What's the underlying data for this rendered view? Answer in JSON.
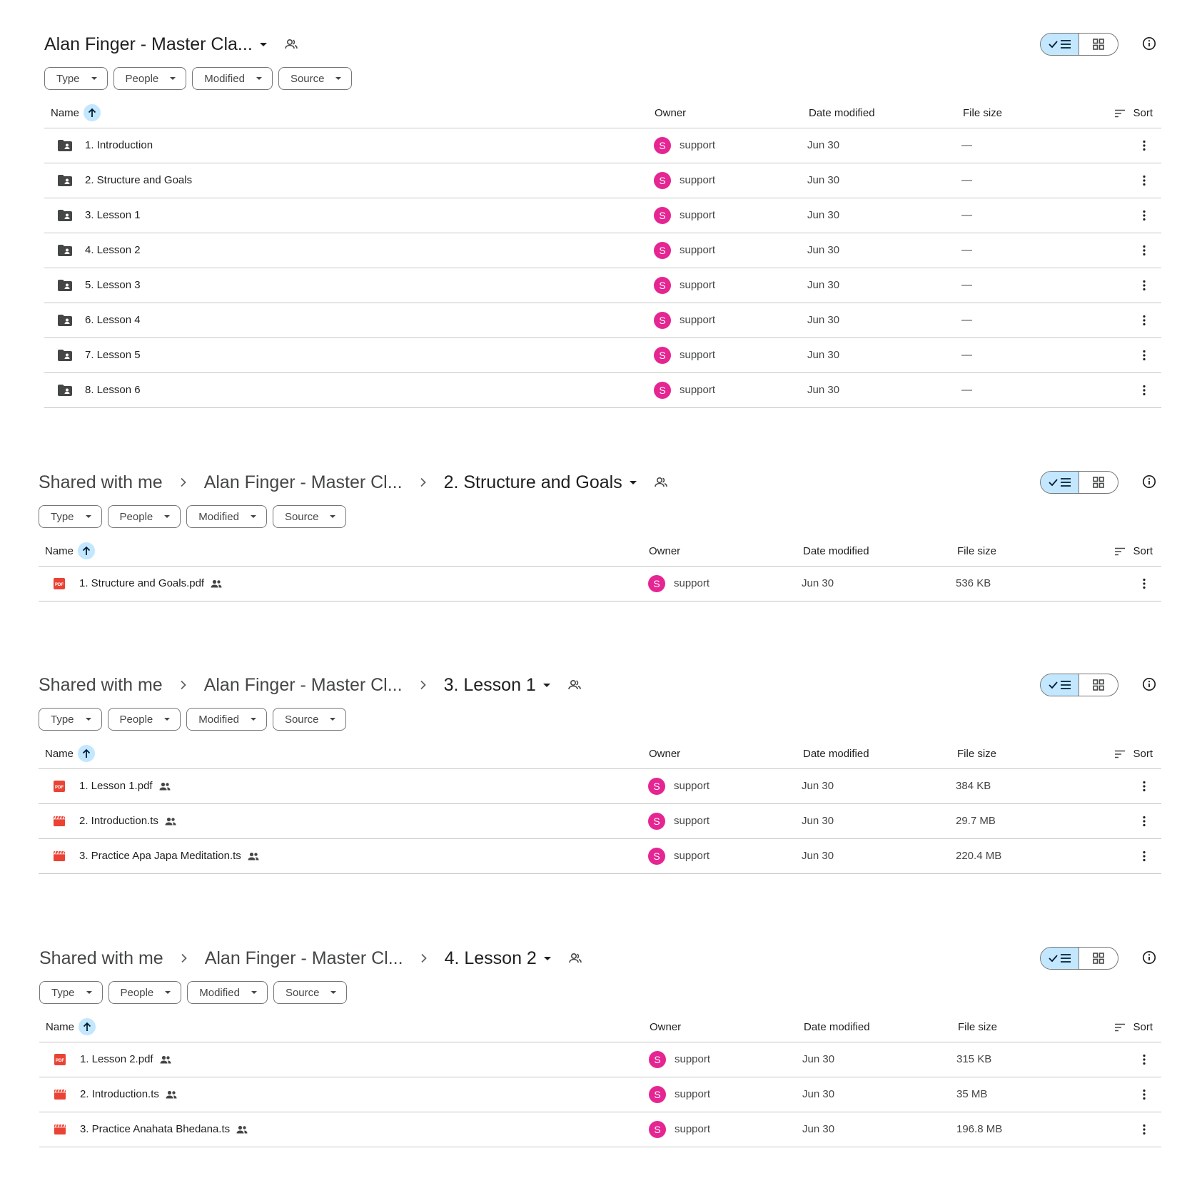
{
  "colors": {
    "accent_light": "#c2e7ff",
    "avatar_bg": "#e52592",
    "pdf_red": "#ea4335",
    "video_red": "#ea4335",
    "folder_dark": "#444746"
  },
  "common": {
    "filters": [
      "Type",
      "People",
      "Modified",
      "Source"
    ],
    "columns": {
      "name": "Name",
      "owner": "Owner",
      "date": "Date modified",
      "size": "File size",
      "sort": "Sort"
    },
    "owner_initial": "S"
  },
  "sections": [
    {
      "breadcrumb_root": "",
      "breadcrumb_parent": "",
      "current": "Alan Finger - Master Cla...",
      "rows": [
        {
          "icon": "shared-folder-icon",
          "name": "1. Introduction",
          "owner": "support",
          "date": "Jun 30",
          "size": "—"
        },
        {
          "icon": "shared-folder-icon",
          "name": "2. Structure and Goals",
          "owner": "support",
          "date": "Jun 30",
          "size": "—"
        },
        {
          "icon": "shared-folder-icon",
          "name": "3. Lesson 1",
          "owner": "support",
          "date": "Jun 30",
          "size": "—"
        },
        {
          "icon": "shared-folder-icon",
          "name": "4. Lesson 2",
          "owner": "support",
          "date": "Jun 30",
          "size": "—"
        },
        {
          "icon": "shared-folder-icon",
          "name": "5. Lesson 3",
          "owner": "support",
          "date": "Jun 30",
          "size": "—"
        },
        {
          "icon": "shared-folder-icon",
          "name": "6. Lesson 4",
          "owner": "support",
          "date": "Jun 30",
          "size": "—"
        },
        {
          "icon": "shared-folder-icon",
          "name": "7. Lesson 5",
          "owner": "support",
          "date": "Jun 30",
          "size": "—"
        },
        {
          "icon": "shared-folder-icon",
          "name": "8. Lesson 6",
          "owner": "support",
          "date": "Jun 30",
          "size": "—"
        }
      ]
    },
    {
      "breadcrumb_root": "Shared with me",
      "breadcrumb_parent": "Alan Finger - Master Cl...",
      "current": "2. Structure and Goals",
      "rows": [
        {
          "icon": "pdf-icon",
          "name": "1. Structure and Goals.pdf",
          "owner": "support",
          "date": "Jun 30",
          "size": "536 KB"
        }
      ]
    },
    {
      "breadcrumb_root": "Shared with me",
      "breadcrumb_parent": "Alan Finger - Master Cl...",
      "current": "3. Lesson 1",
      "rows": [
        {
          "icon": "pdf-icon",
          "name": "1. Lesson 1.pdf",
          "owner": "support",
          "date": "Jun 30",
          "size": "384 KB"
        },
        {
          "icon": "video-icon",
          "name": "2. Introduction.ts",
          "owner": "support",
          "date": "Jun 30",
          "size": "29.7 MB"
        },
        {
          "icon": "video-icon",
          "name": "3. Practice Apa Japa Meditation.ts",
          "owner": "support",
          "date": "Jun 30",
          "size": "220.4 MB"
        }
      ]
    },
    {
      "breadcrumb_root": "Shared with me",
      "breadcrumb_parent": "Alan Finger - Master Cl...",
      "current": "4. Lesson 2",
      "rows": [
        {
          "icon": "pdf-icon",
          "name": "1. Lesson 2.pdf",
          "owner": "support",
          "date": "Jun 30",
          "size": "315 KB"
        },
        {
          "icon": "video-icon",
          "name": "2. Introduction.ts",
          "owner": "support",
          "date": "Jun 30",
          "size": "35 MB"
        },
        {
          "icon": "video-icon",
          "name": "3. Practice Anahata Bhedana.ts",
          "owner": "support",
          "date": "Jun 30",
          "size": "196.8 MB"
        }
      ]
    }
  ]
}
